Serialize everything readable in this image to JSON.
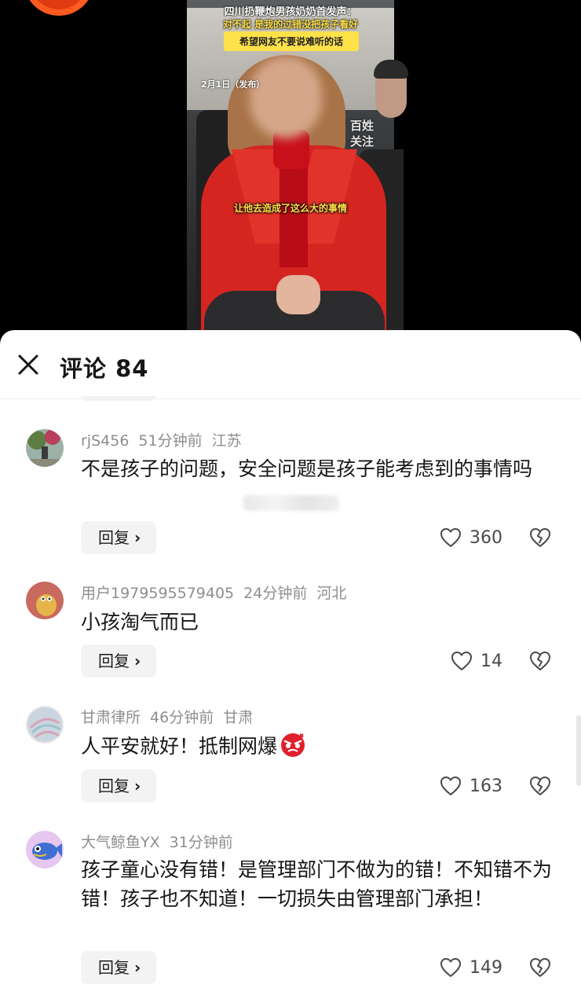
{
  "video": {
    "caption_line1": "四川扔鞭炮男孩奶奶首发声：",
    "caption_line2": "对不起 是我的过错没把孩子看好",
    "caption_line3": "希望网友不要说难听的话",
    "date_label": "2月1日（发布）",
    "watermark": "百姓\n关注",
    "subtitle": "让他去造成了这么大的事情"
  },
  "sheet": {
    "title": "评论 84",
    "close_icon": "close-icon"
  },
  "comments": [
    {
      "user": "rjS456",
      "time": "51分钟前",
      "location": "江苏",
      "text": "不是孩子的问题，安全问题是孩子能考虑到的事情吗",
      "reply_label": "回复",
      "likes": "360"
    },
    {
      "user": "用户1979595579405",
      "time": "24分钟前",
      "location": "河北",
      "text": "小孩淘气而已",
      "reply_label": "回复",
      "likes": "14"
    },
    {
      "user": "甘肃律所",
      "time": "46分钟前",
      "location": "甘肃",
      "text": "人平安就好！抵制网爆",
      "reply_label": "回复",
      "likes": "163"
    },
    {
      "user": "大气鲸鱼YX",
      "time": "31分钟前",
      "location": "",
      "text": "孩子童心没有错！是管理部门不做为的错！不知错不为错！孩子也不知道！一切损失由管理部门承担！",
      "reply_label": "回复",
      "likes": "149"
    }
  ],
  "colors": {
    "meta_gray": "#8e8e8e",
    "text_dark": "#161616",
    "reply_bg": "#f3f3f3",
    "caption_yellow": "#ffe14a",
    "coat_red": "#d42520"
  }
}
